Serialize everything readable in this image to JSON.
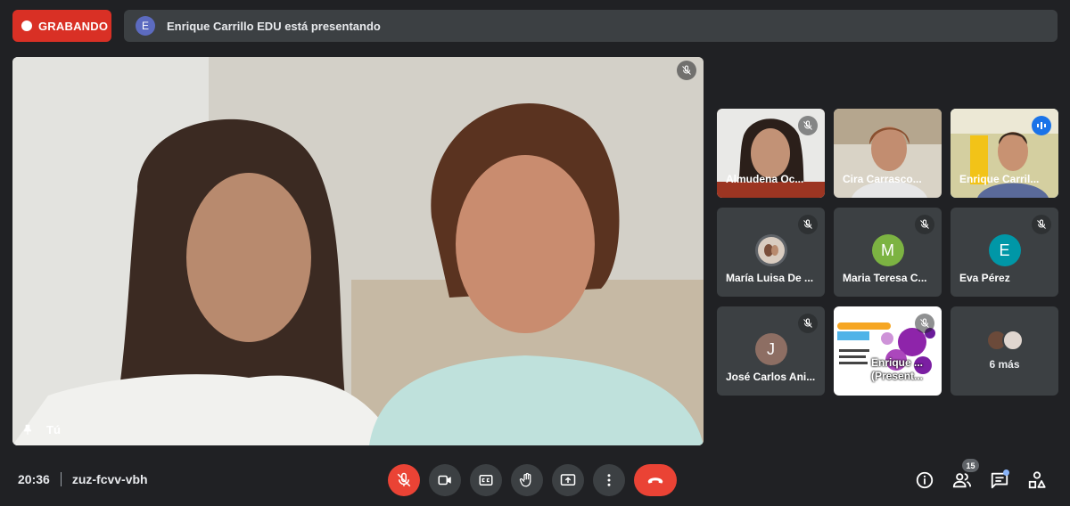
{
  "recording": {
    "label": "GRABANDO"
  },
  "presenting": {
    "avatar_letter": "E",
    "text": "Enrique Carrillo EDU está presentando"
  },
  "main_video": {
    "name": "Tú",
    "muted": true
  },
  "tiles": [
    {
      "name": "Almudena Oc...",
      "type": "video",
      "muted": true
    },
    {
      "name": "Cira Carrasco...",
      "type": "video",
      "muted": false
    },
    {
      "name": "Enrique Carril...",
      "type": "video",
      "speaking": true
    },
    {
      "name": "María Luisa De ...",
      "type": "photo-avatar",
      "muted": true
    },
    {
      "name": "Maria Teresa C...",
      "type": "letter-avatar",
      "letter": "M",
      "color": "#7cb342",
      "muted": true
    },
    {
      "name": "Eva Pérez",
      "type": "letter-avatar",
      "letter": "E",
      "color": "#0097a7",
      "muted": true
    },
    {
      "name": "José Carlos Ani...",
      "type": "letter-avatar",
      "letter": "J",
      "color": "#8d6e63",
      "muted": true
    },
    {
      "name": "Enrique ...",
      "name_line2": "(Present...",
      "type": "presentation",
      "muted": true
    },
    {
      "type": "overflow",
      "label": "6 más"
    }
  ],
  "meeting": {
    "time": "20:36",
    "code": "zuz-fcvv-vbh"
  },
  "controls": [
    "mic-off-icon",
    "camera-icon",
    "captions-icon",
    "raise-hand-icon",
    "present-icon",
    "more-options-icon",
    "end-call-icon"
  ],
  "right_controls": {
    "participants_count": "15"
  },
  "colors": {
    "background": "#202124",
    "tile": "#3c4043",
    "recording": "#d93025",
    "end_call": "#ea4335",
    "accent": "#8ab4f8"
  }
}
